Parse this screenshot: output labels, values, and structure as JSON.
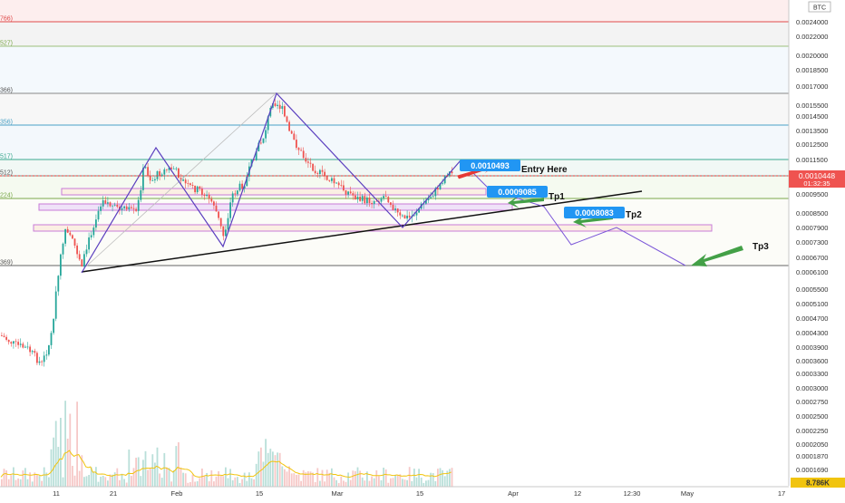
{
  "symbol_badge": "BTC",
  "chart_data": {
    "type": "candlestick",
    "quote_currency": "BTC",
    "price_scale": [
      "0.0024000",
      "0.0022000",
      "0.0020000",
      "0.0018500",
      "0.0017000",
      "0.0015500",
      "0.0014500",
      "0.0013500",
      "0.0012500",
      "0.0011500",
      "0.0009500",
      "0.0008500",
      "0.0007900",
      "0.0007300",
      "0.0006700",
      "0.0006100",
      "0.0005500",
      "0.0005100",
      "0.0004700",
      "0.0004300",
      "0.0003900",
      "0.0003600",
      "0.0003300",
      "0.0003000",
      "0.0002750",
      "0.0002500",
      "0.0002250",
      "0.0002050",
      "0.0001870",
      "0.0001690"
    ],
    "time_axis": [
      "11",
      "21",
      "Feb",
      "15",
      "Mar",
      "15",
      "Apr",
      "12",
      "12:30",
      "May",
      "17"
    ],
    "current_price": "0.0010448",
    "countdown": "01:32:35",
    "volume_label": "8.786K",
    "fib_levels": [
      {
        "label": "766)",
        "color": "#e04a4a"
      },
      {
        "label": "527)",
        "color": "#7aa84a"
      },
      {
        "label": "366)",
        "color": "#555555"
      },
      {
        "label": "356)",
        "color": "#49a1c7"
      },
      {
        "label": "517)",
        "color": "#3aa88f"
      },
      {
        "label": "512)",
        "color": "#555555"
      },
      {
        "label": "224)",
        "color": "#7aa84a"
      },
      {
        "label": "369)",
        "color": "#555555"
      }
    ],
    "targets": [
      {
        "name": "Entry Here",
        "price": "0.0010493"
      },
      {
        "name": "Tp1",
        "price": "0.0009085"
      },
      {
        "name": "Tp2",
        "price": "0.0008083"
      },
      {
        "name": "Tp3",
        "price": ""
      }
    ],
    "colors": {
      "up": "#26a69a",
      "down": "#ef5350",
      "accent": "#2196f3",
      "pattern": "#5b3fbf"
    }
  }
}
